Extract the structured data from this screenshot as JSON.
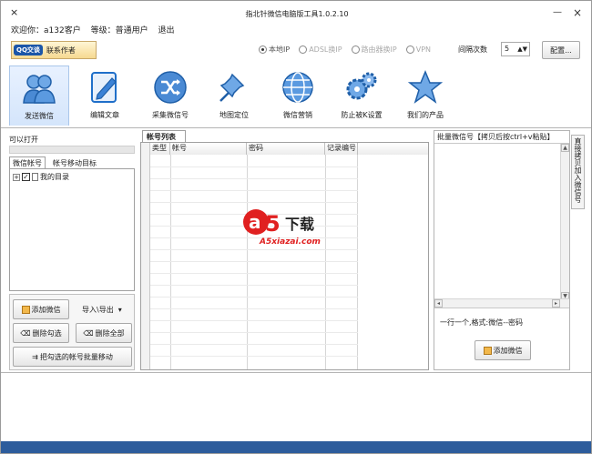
{
  "window": {
    "title": "指北针微信电脑版工具1.0.2.10",
    "close_glyph": "×",
    "minimize_glyph": "—"
  },
  "info": {
    "welcome": "欢迎你：a132客户",
    "level": "等级：普通用户",
    "logout": "退出"
  },
  "qq": {
    "badge": "QQ交谈",
    "label": "联系作者"
  },
  "network": {
    "options": [
      {
        "label": "本地IP",
        "selected": true,
        "disabled": false
      },
      {
        "label": "ADSL换IP",
        "selected": false,
        "disabled": true
      },
      {
        "label": "路由器换IP",
        "selected": false,
        "disabled": true
      },
      {
        "label": "VPN",
        "selected": false,
        "disabled": true
      }
    ],
    "interval_label": "间隔次数",
    "interval_value": "5",
    "config_button": "配置..."
  },
  "tools": [
    {
      "label": "发送微信",
      "icon": "users-icon"
    },
    {
      "label": "编辑文章",
      "icon": "edit-icon"
    },
    {
      "label": "采集微信号",
      "icon": "shuffle-icon"
    },
    {
      "label": "地图定位",
      "icon": "pin-icon"
    },
    {
      "label": "微信营销",
      "icon": "globe-icon"
    },
    {
      "label": "防止被K设置",
      "icon": "gears-icon"
    },
    {
      "label": "我们的产品",
      "icon": "star-icon"
    }
  ],
  "left": {
    "open_label": "可以打开",
    "tabs": [
      "微信帐号",
      "帐号移动目标"
    ],
    "tree_item": "我的目录",
    "add_button": "添加微信",
    "import_export": "导入\\导出",
    "delete_selected": "删除勾选",
    "delete_all": "删除全部",
    "batch_move": "把勾选的帐号批量移动"
  },
  "center": {
    "tab": "帐号列表",
    "columns": [
      "类型",
      "帐号",
      "密码",
      "记录编号"
    ],
    "watermark_main": "下载",
    "watermark_sub": "A5xiazai.com"
  },
  "right": {
    "header": "批量微信号【拷贝后按ctrl+v粘贴】",
    "hint": "一行一个,格式:微信--密码",
    "add_button": "添加微信",
    "side_tab": "直接拷贝加入微信号"
  },
  "colors": {
    "accent": "#1f6fc9",
    "status_bar": "#2d5c9c"
  }
}
